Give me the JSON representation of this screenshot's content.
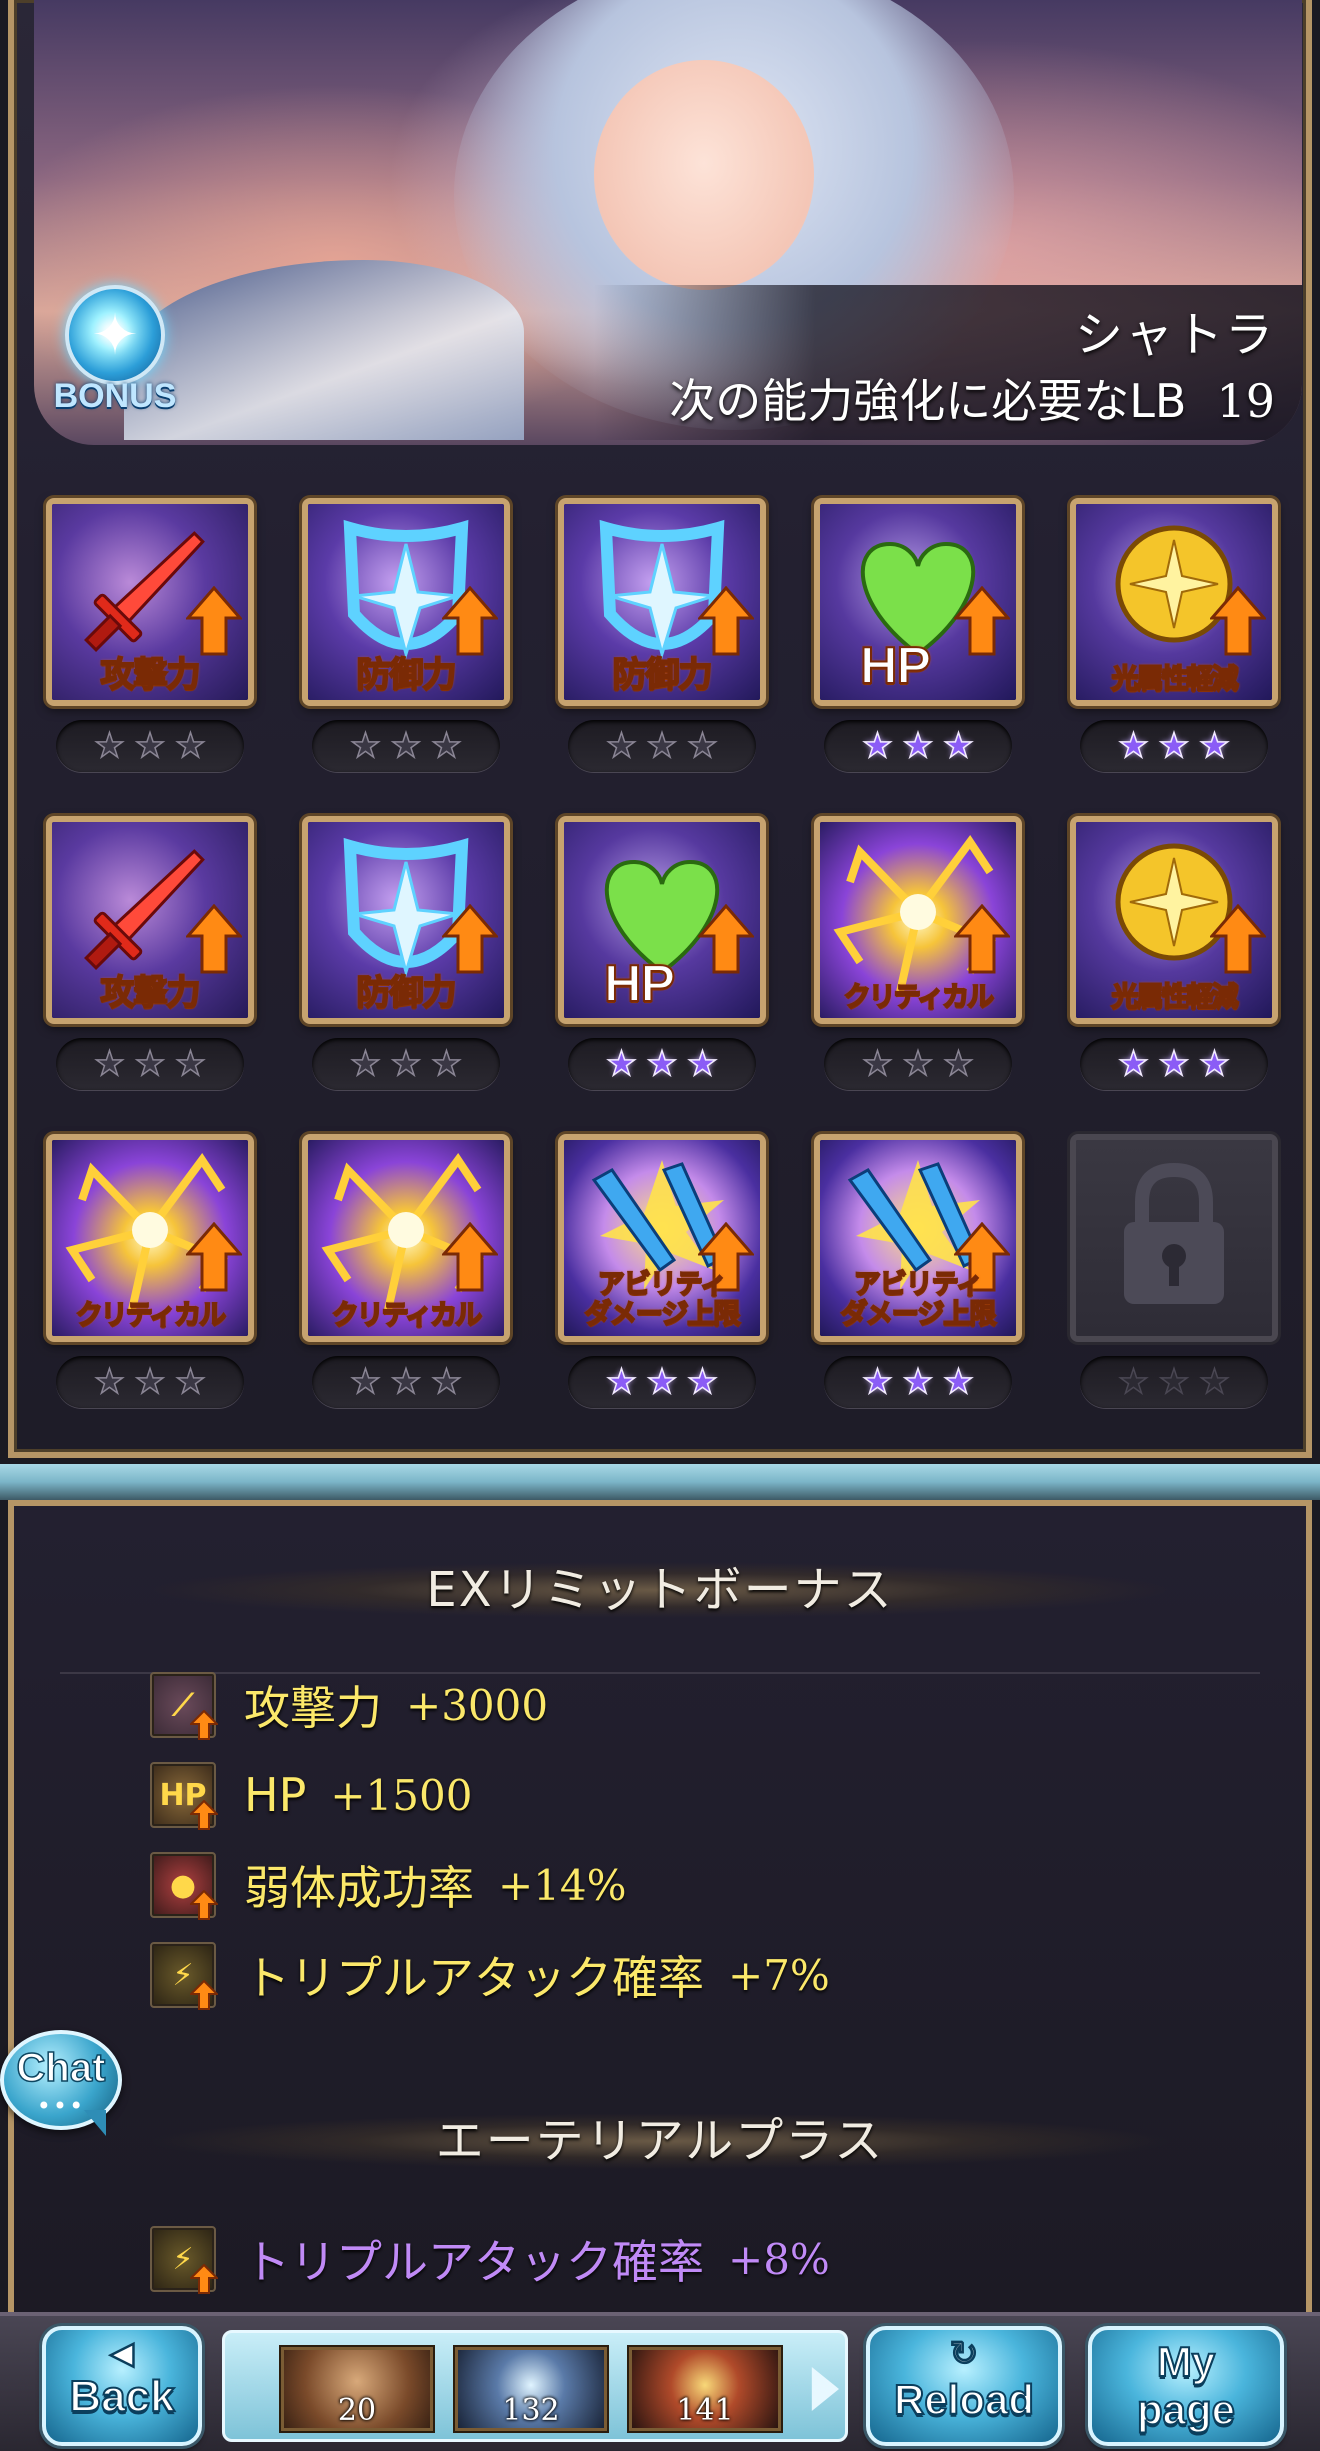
{
  "character": {
    "name": "シャトラ",
    "next_lb_label": "次の能力強化に必要なLB",
    "next_lb_value": "19",
    "bonus_badge": "BONUS"
  },
  "grid": [
    {
      "type": "sword",
      "icon": "sword-up-icon",
      "label": "攻撃力",
      "stars": 0
    },
    {
      "type": "shield",
      "icon": "shield-up-icon",
      "label": "防御力",
      "stars": 0
    },
    {
      "type": "shield",
      "icon": "shield-up-icon",
      "label": "防御力",
      "stars": 0
    },
    {
      "type": "hp",
      "icon": "heart-up-icon",
      "label": "HP",
      "stars": 3
    },
    {
      "type": "light",
      "icon": "light-resist-icon",
      "label": "光属性軽減",
      "stars": 3
    },
    {
      "type": "sword",
      "icon": "sword-up-icon",
      "label": "攻撃力",
      "stars": 0
    },
    {
      "type": "shield",
      "icon": "shield-up-icon",
      "label": "防御力",
      "stars": 0
    },
    {
      "type": "hp",
      "icon": "heart-up-icon",
      "label": "HP",
      "stars": 3
    },
    {
      "type": "crit",
      "icon": "critical-up-icon",
      "label": "クリティカル",
      "stars": 0
    },
    {
      "type": "light",
      "icon": "light-resist-icon",
      "label": "光属性軽減",
      "stars": 3
    },
    {
      "type": "crit",
      "icon": "critical-up-icon",
      "label": "クリティカル",
      "stars": 0
    },
    {
      "type": "crit",
      "icon": "critical-up-icon",
      "label": "クリティカル",
      "stars": 0
    },
    {
      "type": "ability",
      "icon": "ability-cap-up-icon",
      "label_line1": "アビリティ",
      "label_line2": "ダメージ上限",
      "stars": 3
    },
    {
      "type": "ability",
      "icon": "ability-cap-up-icon",
      "label_line1": "アビリティ",
      "label_line2": "ダメージ上限",
      "stars": 3
    },
    {
      "type": "locked",
      "icon": "lock-icon",
      "label": "",
      "stars": 0
    }
  ],
  "ex_limit": {
    "title": "EXリミットボーナス",
    "rows": [
      {
        "icon": "attack-up-icon",
        "name": "攻撃力",
        "value": "+3000"
      },
      {
        "icon": "hp-up-icon",
        "name": "HP",
        "value": "+1500"
      },
      {
        "icon": "debuff-success-icon",
        "name": "弱体成功率",
        "value": "+14%"
      },
      {
        "icon": "triple-attack-icon",
        "name": "トリプルアタック確率",
        "value": "+7%"
      }
    ]
  },
  "ethereal": {
    "title": "エーテリアルプラス",
    "rows": [
      {
        "icon": "triple-attack-icon",
        "name": "トリプルアタック確率",
        "value": "+8%"
      }
    ]
  },
  "chat": {
    "label": "Chat",
    "dots": "•••"
  },
  "footer": {
    "back_label": "Back",
    "reload_label": "Reload",
    "mypage_line1": "My",
    "mypage_line2": "page",
    "items": [
      {
        "icon": "item-icon-1",
        "count": "20"
      },
      {
        "icon": "item-icon-2",
        "count": "132"
      },
      {
        "icon": "item-icon-3",
        "count": "141"
      }
    ]
  },
  "colors": {
    "gold_text": "#fbe86a",
    "purple_text": "#c08af6",
    "star_on": "#8b5cf6",
    "frame_gold": "#b59566"
  }
}
